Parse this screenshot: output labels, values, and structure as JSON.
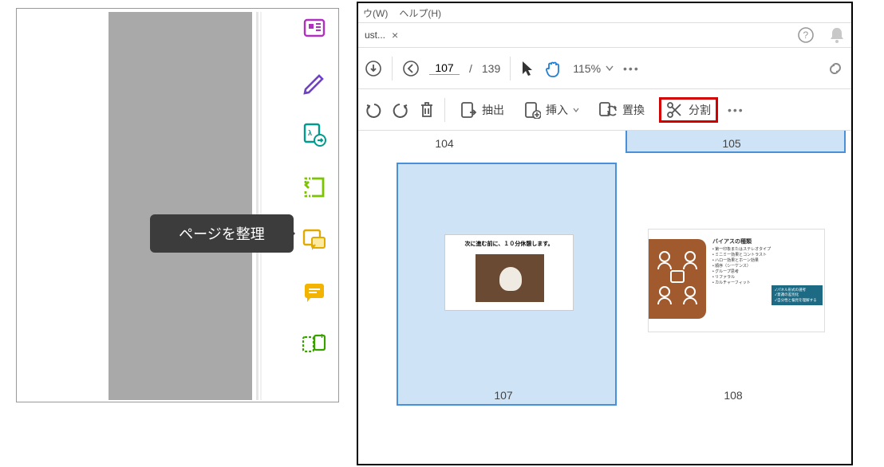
{
  "left_panel": {
    "tooltip": "ページを整理",
    "rail_icons": [
      "pdf-icon",
      "edit-icon",
      "export-icon",
      "organize-icon",
      "comment-icon",
      "note-icon",
      "compare-icon"
    ]
  },
  "menubar": {
    "window": "ウ(W)",
    "help": "ヘルプ(H)"
  },
  "tab": {
    "name": "ust...",
    "close": "×"
  },
  "titlebar_icons": {
    "help": "?",
    "bell": "🔔"
  },
  "toolbar": {
    "current_page": "107",
    "total_pages": "139",
    "page_sep": "/",
    "zoom": "115%",
    "more": "•••"
  },
  "orgbar": {
    "extract": "抽出",
    "insert": "挿入",
    "replace": "置換",
    "split": "分割",
    "more": "•••"
  },
  "thumbs": {
    "labels": {
      "104": "104",
      "105": "105",
      "107": "107",
      "108": "108"
    },
    "p107_title": "次に進む前に、１０分休憩します。",
    "p108_title": "バイアスの種類",
    "p108_items": [
      "• 第一印象またはステレオタイプ",
      "• ミニミー効果とコントラスト",
      "• ハロー効果とホーン効果",
      "• 順序（シーケンス）",
      "• グループ思考",
      "• リファラル",
      "• カルチャーフィット"
    ],
    "p108_badge": [
      "✓パネル形式の選考",
      "✓意識の差別化",
      "✓自分性と偏見を理解する"
    ]
  }
}
